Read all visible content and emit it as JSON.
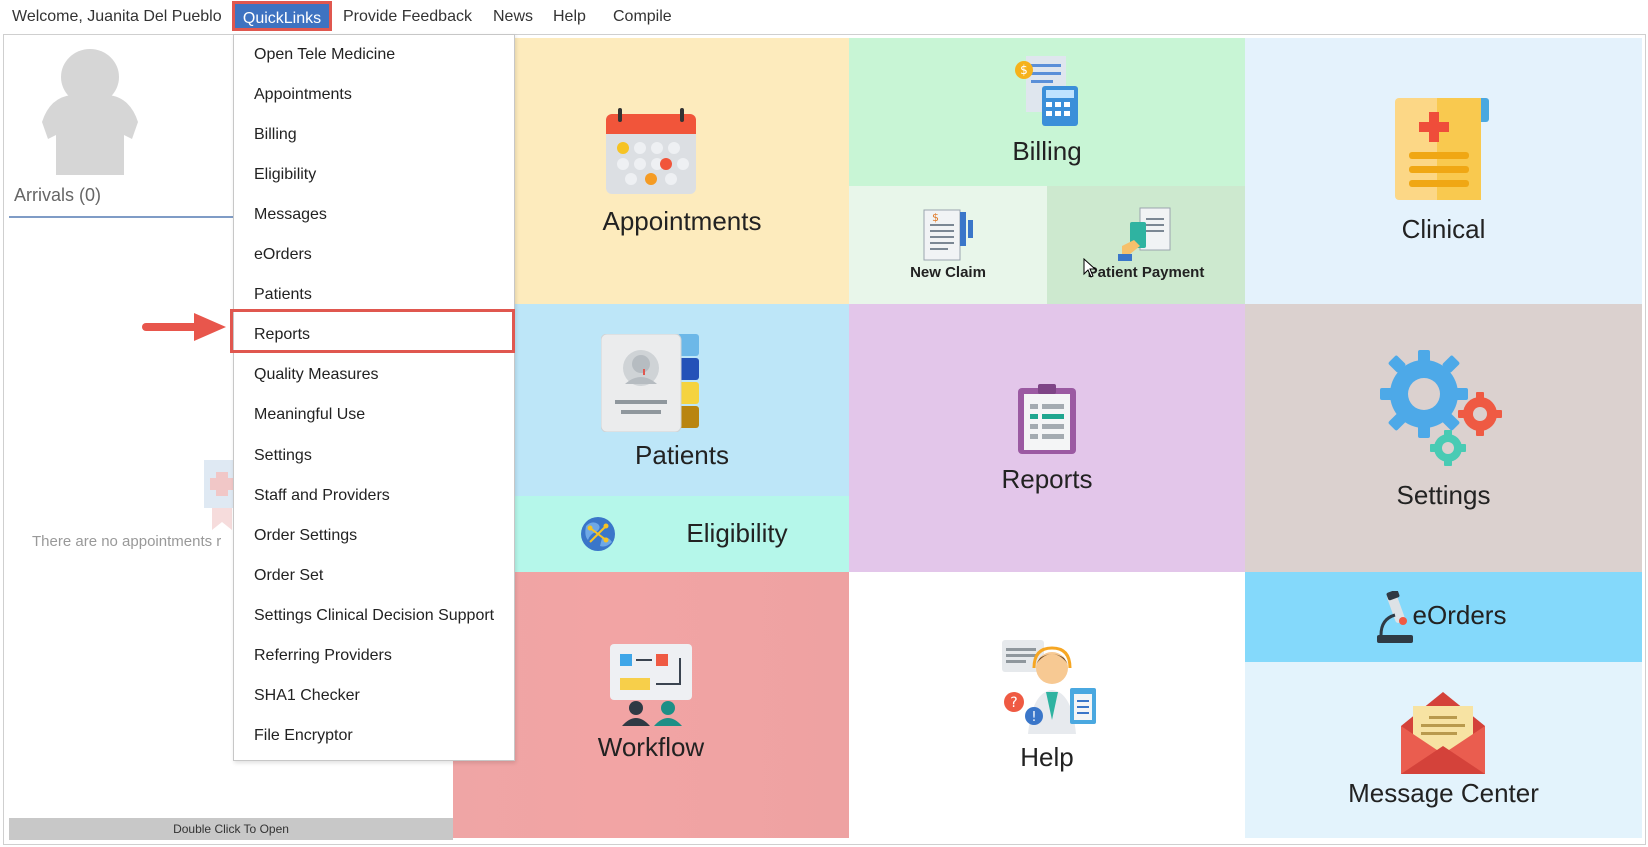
{
  "menubar": {
    "welcome": "Welcome, Juanita Del Pueblo",
    "quicklinks": "QuickLinks",
    "feedback": "Provide Feedback",
    "news": "News",
    "help": "Help",
    "compile": "Compile"
  },
  "left_panel": {
    "arrivals": "Arrivals (0)",
    "no_appointments": "There are no appointments r",
    "double_click": "Double Click To Open"
  },
  "quicklinks_menu": {
    "items": [
      "Open Tele Medicine",
      "Appointments",
      "Billing",
      "Eligibility",
      "Messages",
      "eOrders",
      "Patients",
      "Reports",
      "Quality Measures",
      "Meaningful Use",
      "Settings",
      "Staff and Providers",
      "Order Settings",
      "Order Set",
      "Settings Clinical Decision Support",
      "Referring Providers",
      "SHA1 Checker",
      "File Encryptor"
    ],
    "highlighted": "Reports"
  },
  "tiles": {
    "appointments": "Appointments",
    "billing": "Billing",
    "new_claim": "New Claim",
    "patient_payment": "Patient Payment",
    "clinical": "Clinical",
    "patients": "Patients",
    "eligibility": "Eligibility",
    "reports": "Reports",
    "settings": "Settings",
    "workflow": "Workflow",
    "help": "Help",
    "eorders": "eOrders",
    "message_center": "Message Center"
  },
  "colors": {
    "quicklinks_bg": "#3e73c1",
    "highlight_border": "#e0574f",
    "appointments_bg": "#fdebbd",
    "billing_bg": "#c8f5d5",
    "new_claim_bg": "#e8f6ea",
    "patient_payment_bg": "#cde9cf",
    "clinical_bg": "#e4f2fc",
    "patients_bg": "#bde6f8",
    "eligibility_bg": "#b5f7ea",
    "reports_bg": "#e3c6ea",
    "settings_bg": "#dbd1cf",
    "workflow_bg": "#efa5a5",
    "help_bg": "#ffffff",
    "eorders_bg": "#84d9fb",
    "message_center_bg": "#e3f3fc"
  }
}
